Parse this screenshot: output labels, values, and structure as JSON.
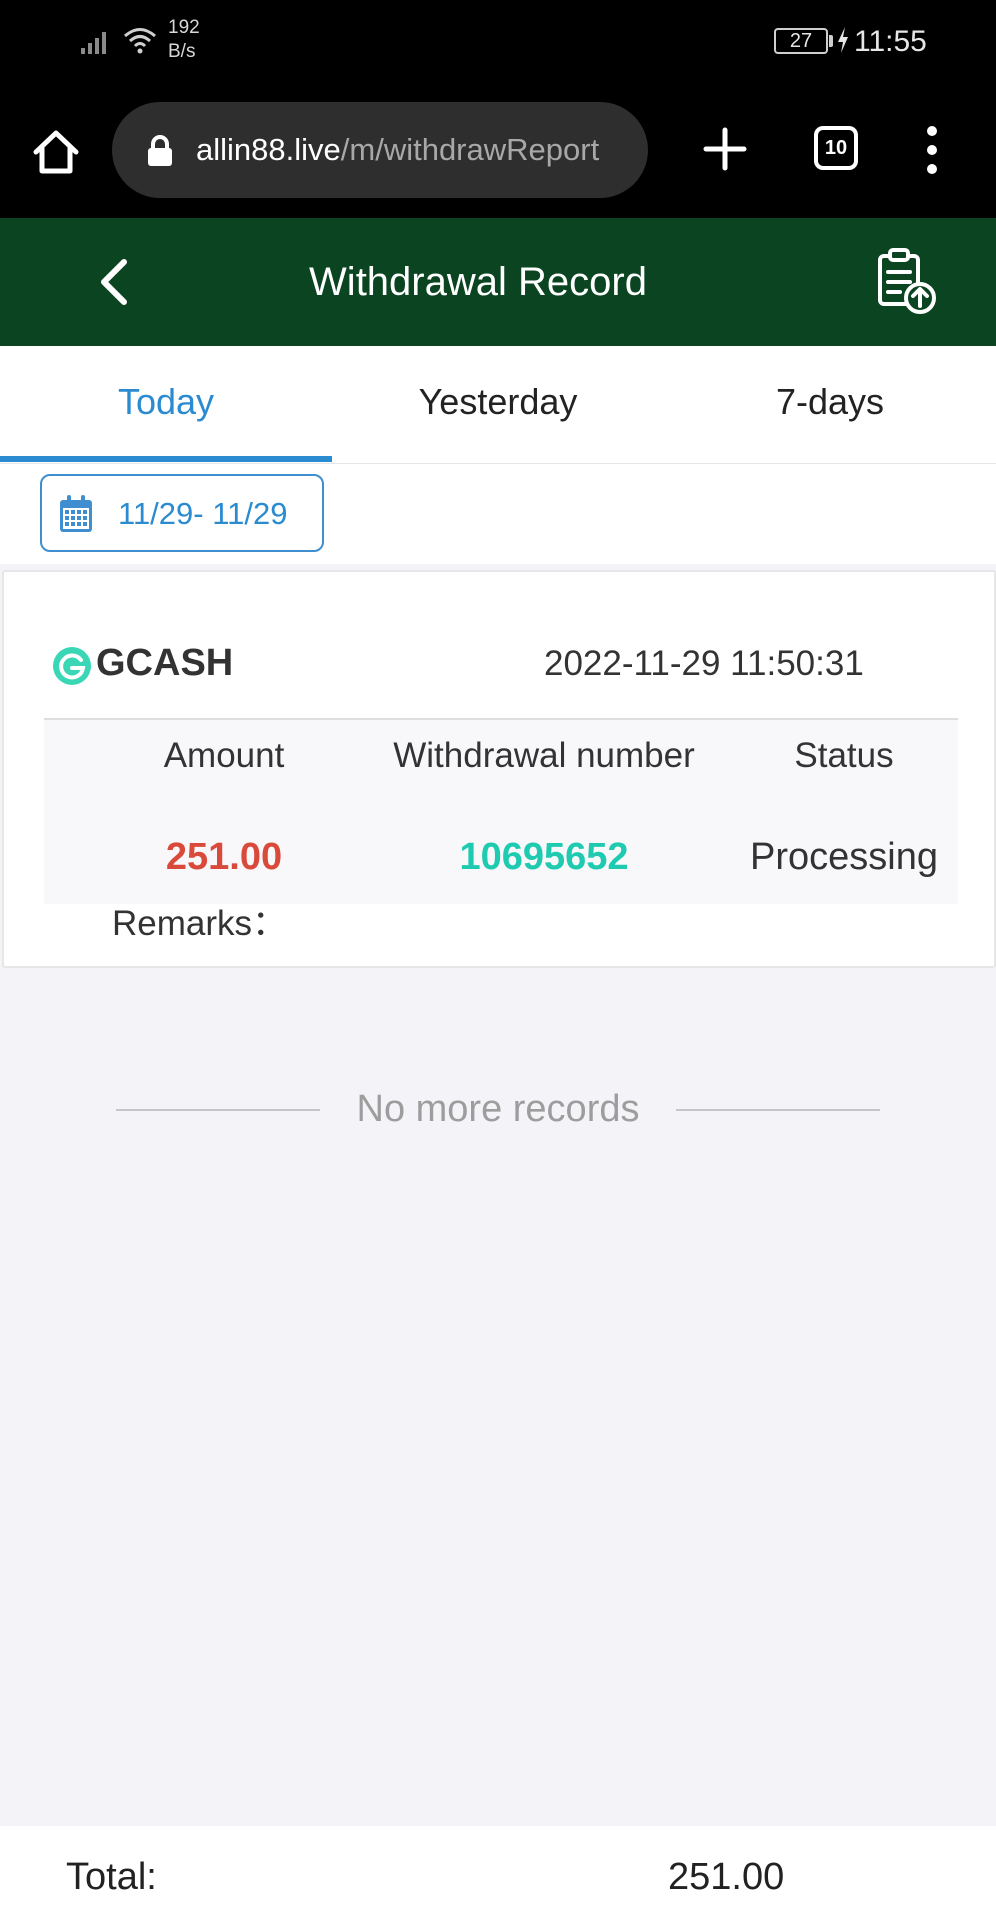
{
  "status_bar": {
    "net_speed_value": "192",
    "net_speed_unit": "B/s",
    "battery_level": "27",
    "time": "11:55",
    "icons": [
      "signal-icon",
      "wifi-icon",
      "battery-icon",
      "charging-icon"
    ]
  },
  "browser": {
    "url_host": "allin88.live",
    "url_path": "/m/withdrawReport",
    "tab_count": "10",
    "icons": [
      "home-icon",
      "lock-icon",
      "plus-icon",
      "more-icon"
    ]
  },
  "header": {
    "title": "Withdrawal Record",
    "icons": [
      "back-arrow-icon",
      "clipboard-upload-icon"
    ],
    "background_color": "#0b4420"
  },
  "tabs": [
    {
      "label": "Today",
      "active": true
    },
    {
      "label": "Yesterday",
      "active": false
    },
    {
      "label": "7-days",
      "active": false
    }
  ],
  "filter": {
    "date_range": "11/29- 11/29",
    "icon": "calendar-icon"
  },
  "record": {
    "method": "GCASH",
    "datetime": "2022-11-29 11:50:31",
    "columns": {
      "amount": "Amount",
      "number": "Withdrawal number",
      "status": "Status"
    },
    "values": {
      "amount": "251.00",
      "number": "10695652",
      "status": "Processing"
    },
    "remarks_label": "Remarks："
  },
  "list_end": {
    "text": "No more records"
  },
  "footer": {
    "total_label": "Total:",
    "total_value": "251.00"
  },
  "colors": {
    "accent_blue": "#2a8bd0",
    "amount_red": "#d94a3a",
    "number_teal": "#1fcbb0"
  }
}
